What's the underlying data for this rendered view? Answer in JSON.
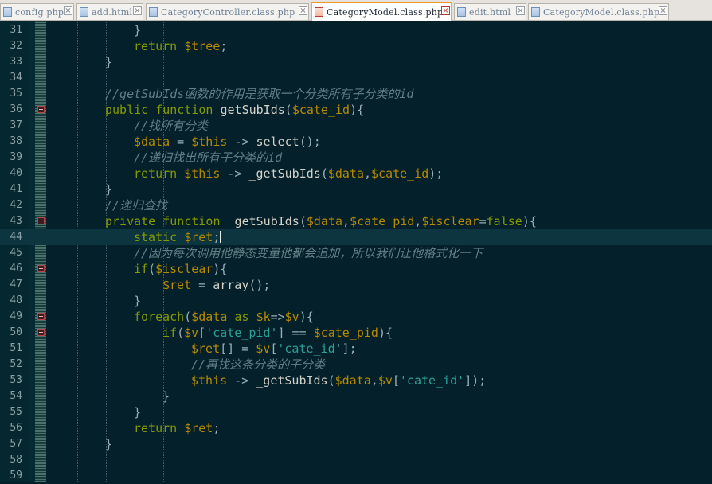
{
  "tabs": [
    {
      "label": "config.php",
      "active": false
    },
    {
      "label": "add.html",
      "active": false
    },
    {
      "label": "CategoryController.class.php",
      "active": false
    },
    {
      "label": "CategoryModel.class.php",
      "active": true
    },
    {
      "label": "edit.html",
      "active": false
    },
    {
      "label": "CategoryModel.class.php",
      "active": false
    }
  ],
  "editor": {
    "current_line": 44,
    "lines": [
      {
        "n": "31",
        "indent": 3,
        "fold": false,
        "t": [
          [
            "p",
            "}"
          ]
        ]
      },
      {
        "n": "32",
        "indent": 3,
        "fold": false,
        "t": [
          [
            "kw",
            "return "
          ],
          [
            "var",
            "$tree"
          ],
          [
            "p",
            ";"
          ]
        ]
      },
      {
        "n": "33",
        "indent": 2,
        "fold": false,
        "t": [
          [
            "p",
            "}"
          ]
        ]
      },
      {
        "n": "34",
        "indent": 0,
        "fold": false,
        "t": []
      },
      {
        "n": "35",
        "indent": 2,
        "fold": false,
        "t": [
          [
            "cmt",
            "//getSubIds函数的作用是获取一个分类所有子分类的id"
          ]
        ]
      },
      {
        "n": "36",
        "indent": 2,
        "fold": true,
        "t": [
          [
            "kw",
            "public function "
          ],
          [
            "fn",
            "getSubIds"
          ],
          [
            "p",
            "("
          ],
          [
            "var",
            "$cate_id"
          ],
          [
            "p",
            "){"
          ]
        ]
      },
      {
        "n": "37",
        "indent": 3,
        "fold": false,
        "t": [
          [
            "cmt",
            "//找所有分类"
          ]
        ]
      },
      {
        "n": "38",
        "indent": 3,
        "fold": false,
        "t": [
          [
            "var",
            "$data"
          ],
          [
            "p",
            " = "
          ],
          [
            "var",
            "$this"
          ],
          [
            "p",
            " -> "
          ],
          [
            "fn",
            "select"
          ],
          [
            "p",
            "();"
          ]
        ]
      },
      {
        "n": "39",
        "indent": 3,
        "fold": false,
        "t": [
          [
            "cmt",
            "//递归找出所有子分类的id"
          ]
        ]
      },
      {
        "n": "40",
        "indent": 3,
        "fold": false,
        "t": [
          [
            "kw",
            "return "
          ],
          [
            "var",
            "$this"
          ],
          [
            "p",
            " -> "
          ],
          [
            "fn",
            "_getSubIds"
          ],
          [
            "p",
            "("
          ],
          [
            "var",
            "$data"
          ],
          [
            "p",
            ","
          ],
          [
            "var",
            "$cate_id"
          ],
          [
            "p",
            ");"
          ]
        ]
      },
      {
        "n": "41",
        "indent": 2,
        "fold": false,
        "t": [
          [
            "p",
            "}"
          ]
        ]
      },
      {
        "n": "42",
        "indent": 2,
        "fold": false,
        "t": [
          [
            "cmt",
            "//递归查找"
          ]
        ]
      },
      {
        "n": "43",
        "indent": 2,
        "fold": true,
        "t": [
          [
            "kw",
            "private function "
          ],
          [
            "fn",
            "_getSubIds"
          ],
          [
            "p",
            "("
          ],
          [
            "var",
            "$data"
          ],
          [
            "p",
            ","
          ],
          [
            "var",
            "$cate_pid"
          ],
          [
            "p",
            ","
          ],
          [
            "var",
            "$isclear"
          ],
          [
            "p",
            "="
          ],
          [
            "kw",
            "false"
          ],
          [
            "p",
            "){"
          ]
        ]
      },
      {
        "n": "44",
        "indent": 3,
        "fold": false,
        "t": [
          [
            "kw",
            "static "
          ],
          [
            "var",
            "$ret"
          ],
          [
            "p",
            ";"
          ],
          [
            "caret",
            ""
          ]
        ]
      },
      {
        "n": "45",
        "indent": 3,
        "fold": false,
        "t": [
          [
            "cmt",
            "//因为每次调用他静态变量他都会追加，所以我们让他格式化一下"
          ]
        ]
      },
      {
        "n": "46",
        "indent": 3,
        "fold": true,
        "t": [
          [
            "kw",
            "if"
          ],
          [
            "p",
            "("
          ],
          [
            "var",
            "$isclear"
          ],
          [
            "p",
            "){"
          ]
        ]
      },
      {
        "n": "47",
        "indent": 4,
        "fold": false,
        "t": [
          [
            "var",
            "$ret"
          ],
          [
            "p",
            " = "
          ],
          [
            "fn",
            "array"
          ],
          [
            "p",
            "();"
          ]
        ]
      },
      {
        "n": "48",
        "indent": 3,
        "fold": false,
        "t": [
          [
            "p",
            "}"
          ]
        ]
      },
      {
        "n": "49",
        "indent": 3,
        "fold": true,
        "t": [
          [
            "kw",
            "foreach"
          ],
          [
            "p",
            "("
          ],
          [
            "var",
            "$data"
          ],
          [
            "kw",
            " as "
          ],
          [
            "var",
            "$k"
          ],
          [
            "p",
            "=>"
          ],
          [
            "var",
            "$v"
          ],
          [
            "p",
            "){"
          ]
        ]
      },
      {
        "n": "50",
        "indent": 4,
        "fold": true,
        "t": [
          [
            "kw",
            "if"
          ],
          [
            "p",
            "("
          ],
          [
            "var",
            "$v"
          ],
          [
            "p",
            "["
          ],
          [
            "str",
            "'cate_pid'"
          ],
          [
            "p",
            "] == "
          ],
          [
            "var",
            "$cate_pid"
          ],
          [
            "p",
            "){"
          ]
        ]
      },
      {
        "n": "51",
        "indent": 5,
        "fold": false,
        "t": [
          [
            "var",
            "$ret"
          ],
          [
            "p",
            "[] = "
          ],
          [
            "var",
            "$v"
          ],
          [
            "p",
            "["
          ],
          [
            "str",
            "'cate_id'"
          ],
          [
            "p",
            "];"
          ]
        ]
      },
      {
        "n": "52",
        "indent": 5,
        "fold": false,
        "t": [
          [
            "cmt",
            "//再找这条分类的子分类"
          ]
        ]
      },
      {
        "n": "53",
        "indent": 5,
        "fold": false,
        "t": [
          [
            "var",
            "$this"
          ],
          [
            "p",
            " -> "
          ],
          [
            "fn",
            "_getSubIds"
          ],
          [
            "p",
            "("
          ],
          [
            "var",
            "$data"
          ],
          [
            "p",
            ","
          ],
          [
            "var",
            "$v"
          ],
          [
            "p",
            "["
          ],
          [
            "str",
            "'cate_id'"
          ],
          [
            "p",
            "]);"
          ]
        ]
      },
      {
        "n": "54",
        "indent": 4,
        "fold": false,
        "t": [
          [
            "p",
            "}"
          ]
        ]
      },
      {
        "n": "55",
        "indent": 3,
        "fold": false,
        "t": [
          [
            "p",
            "}"
          ]
        ]
      },
      {
        "n": "56",
        "indent": 3,
        "fold": false,
        "t": [
          [
            "kw",
            "return "
          ],
          [
            "var",
            "$ret"
          ],
          [
            "p",
            ";"
          ]
        ]
      },
      {
        "n": "57",
        "indent": 2,
        "fold": false,
        "t": [
          [
            "p",
            "}"
          ]
        ]
      },
      {
        "n": "58",
        "indent": 0,
        "fold": false,
        "t": []
      },
      {
        "n": "59",
        "indent": 0,
        "fold": false,
        "t": []
      }
    ]
  },
  "colors": {
    "background": "#04212b",
    "keyword": "#859900",
    "variable": "#b58900",
    "string": "#2aa198",
    "comment": "#637e85",
    "active_tab_accent": "#f0962c"
  },
  "icons": {
    "tab_file": "file-icon",
    "tab_close": "close-icon",
    "fold_marker": "fold-collapse-icon"
  }
}
